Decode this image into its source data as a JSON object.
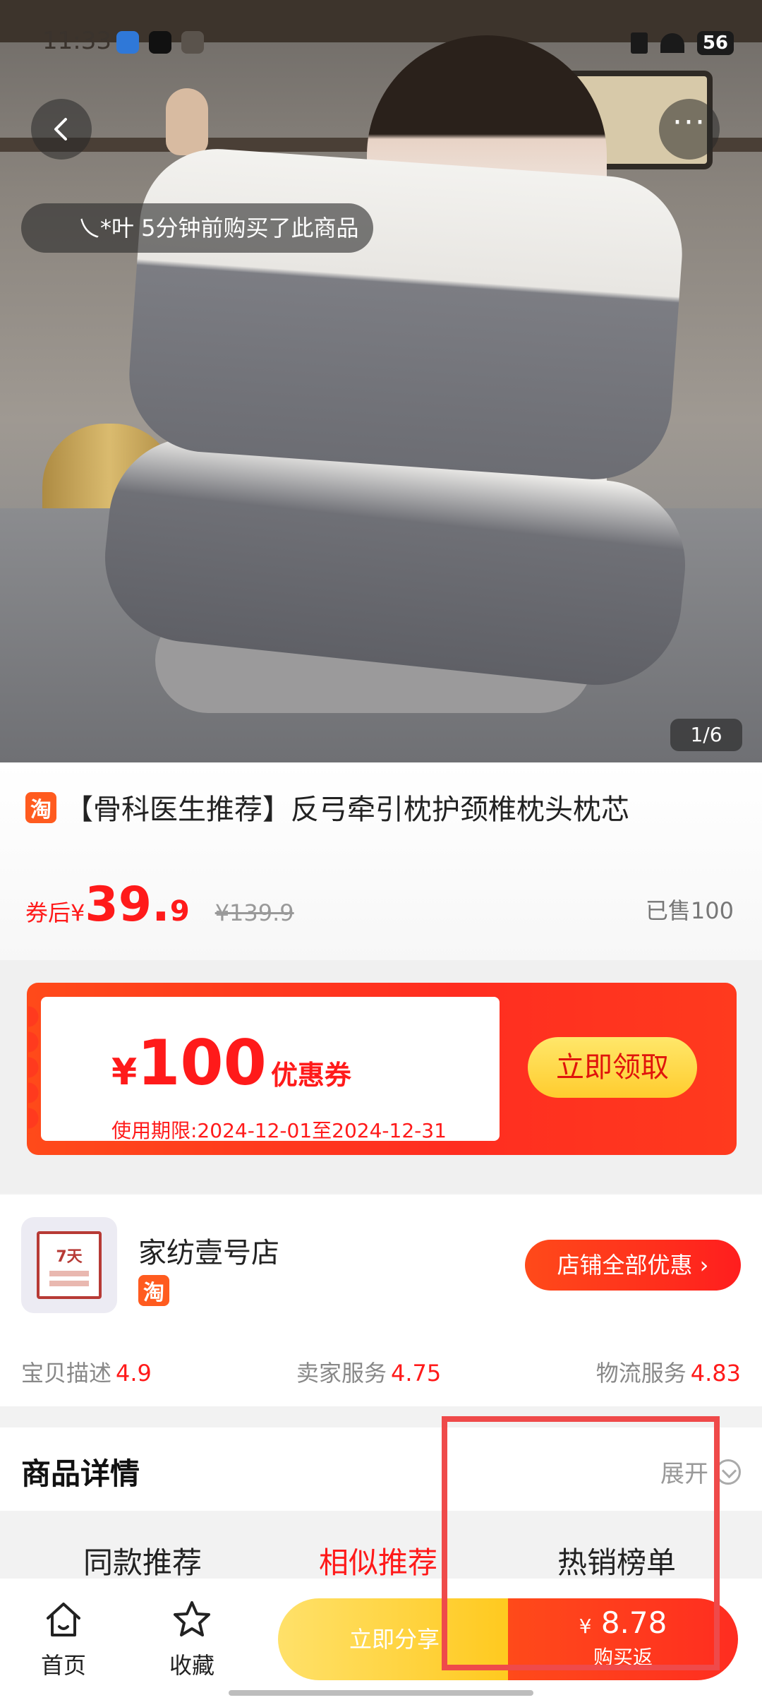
{
  "status_bar": {
    "time": "11:33",
    "battery": "56"
  },
  "hero": {
    "buyer_toast": "乀*叶  5分钟前购买了此商品",
    "image_counter": "1/6"
  },
  "product": {
    "title": "【骨科医生推荐】反弓牵引枕护颈椎枕头枕芯",
    "price_prefix": "券后¥",
    "price_int": "39.",
    "price_dec": "9",
    "original_price": "¥139.9",
    "sold": "已售100"
  },
  "coupon": {
    "currency": "¥",
    "amount": "100",
    "label": "优惠券",
    "validity": "使用期限:2024-12-01至2024-12-31",
    "claim_button": "立即领取"
  },
  "store": {
    "name": "家纺壹号店",
    "logo_text": "7天",
    "all_deals_button": "店铺全部优惠 ›",
    "ratings": [
      {
        "label": "宝贝描述",
        "value": "4.9"
      },
      {
        "label": "卖家服务",
        "value": "4.75"
      },
      {
        "label": "物流服务",
        "value": "4.83"
      }
    ]
  },
  "details": {
    "title": "商品详情",
    "expand": "展开"
  },
  "reco_tabs": [
    "同款推荐",
    "相似推荐",
    "热销榜单"
  ],
  "bottom_bar": {
    "home": "首页",
    "favorite": "收藏",
    "share": "立即分享",
    "buy_amount_currency": "¥",
    "buy_amount": "8.78",
    "buy_label": "购买返"
  },
  "taobao_badge": "淘",
  "colors": {
    "accent": "#ff1a1a",
    "brand_orange": "#ff5b1f",
    "highlight": "#ef4a4a"
  }
}
